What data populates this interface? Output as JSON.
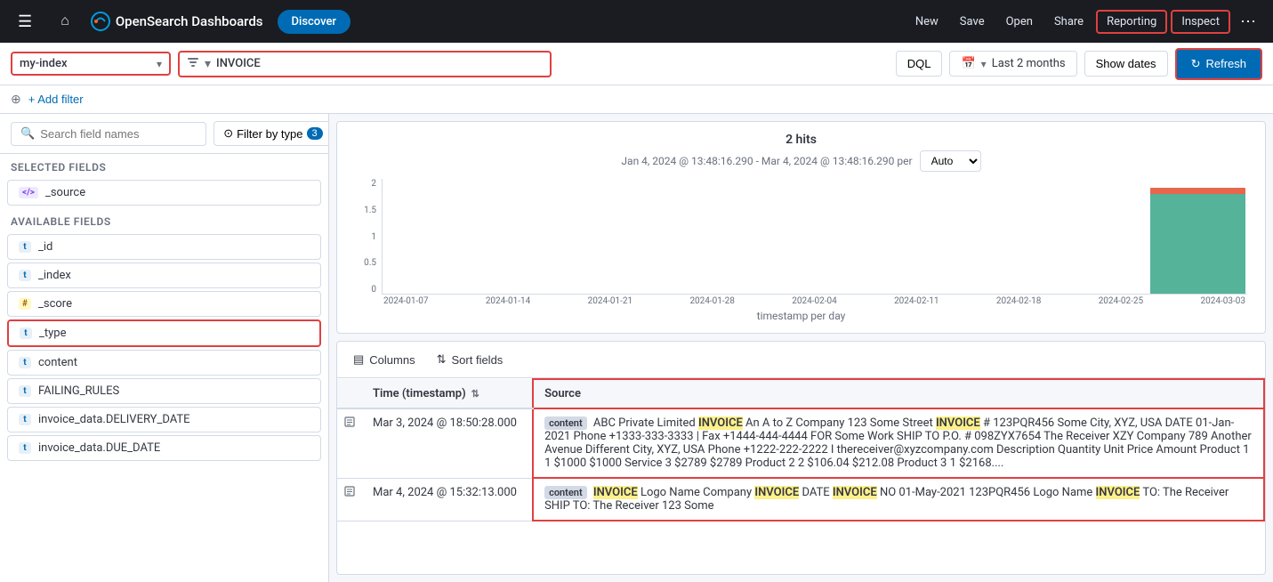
{
  "app": {
    "logo_text": "OpenSearch Dashboards",
    "active_tab": "Discover"
  },
  "top_nav": {
    "links": [
      "New",
      "Save",
      "Open",
      "Share",
      "Reporting",
      "Inspect"
    ],
    "hamburger_icon": "☰",
    "home_icon": "⌂"
  },
  "toolbar": {
    "index_name": "my-index",
    "query_text": "INVOICE",
    "dql_label": "DQL",
    "date_range": "Last 2 months",
    "show_dates_label": "Show dates",
    "refresh_label": "Refresh",
    "refresh_icon": "↻"
  },
  "filter_row": {
    "add_filter_label": "+ Add filter"
  },
  "sidebar": {
    "search_placeholder": "Search field names",
    "filter_by_type_label": "Filter by type",
    "filter_count": "3",
    "selected_section_label": "Selected fields",
    "available_section_label": "Available fields",
    "selected_fields": [
      {
        "type": "</>",
        "type_class": "code",
        "name": "_source"
      }
    ],
    "available_fields": [
      {
        "type": "t",
        "type_class": "text",
        "name": "_id"
      },
      {
        "type": "t",
        "type_class": "text",
        "name": "_index"
      },
      {
        "type": "#",
        "type_class": "hash",
        "name": "_score"
      },
      {
        "type": "t",
        "type_class": "text",
        "name": "_type"
      },
      {
        "type": "t",
        "type_class": "text",
        "name": "content"
      },
      {
        "type": "t",
        "type_class": "text",
        "name": "FAILING_RULES"
      },
      {
        "type": "t",
        "type_class": "text",
        "name": "invoice_data.DELIVERY_DATE"
      },
      {
        "type": "t",
        "type_class": "text",
        "name": "invoice_data.DUE_DATE"
      }
    ]
  },
  "chart": {
    "hits_label": "2 hits",
    "date_range_label": "Jan 4, 2024 @ 13:48:16.290 - Mar 4, 2024 @ 13:48:16.290 per",
    "per_label": "Auto",
    "x_axis_title": "timestamp per day",
    "y_labels": [
      "2",
      "1.5",
      "1",
      "0.5",
      "0"
    ],
    "x_labels": [
      "2024-01-07",
      "2024-01-14",
      "2024-01-21",
      "2024-01-28",
      "2024-02-04",
      "2024-02-11",
      "2024-02-18",
      "2024-02-25",
      "2024-03-03"
    ],
    "bars": [
      0,
      0,
      0,
      0,
      0,
      0,
      0,
      0,
      95
    ]
  },
  "results": {
    "columns_label": "Columns",
    "sort_fields_label": "Sort fields",
    "columns_icon": "▤",
    "sort_icon": "⇅",
    "headers": [
      {
        "label": "Time (timestamp)",
        "has_sort": true
      },
      {
        "label": "Source",
        "has_sort": false
      }
    ],
    "rows": [
      {
        "time": "Mar 3, 2024 @ 18:50:28.000",
        "source_prefix": "content",
        "source_text": " ABC Private Limited INVOICE An A to Z Company 123 Some Street INVOICE # 123PQR456 Some City, XYZ, USA DATE 01-Jan-2021 Phone +1333-333-3333 | Fax +1444-444-4444 FOR Some Work SHIP TO P.O. # 098ZYX7654 The Receiver XZY Company 789 Another Avenue Different City, XYZ, USA Phone +1222-222-2222 I thereceiver@xyzcompany.com Description Quantity Unit Price Amount Product 1 1 $1000 $1000 Service 3 $2789 $2789 Product 2 2 $106.04 $212.08 Product 3 1 $2168....",
        "highlights": [
          "INVOICE",
          "INVOICE"
        ]
      },
      {
        "time": "Mar 4, 2024 @ 15:32:13.000",
        "source_prefix": "content",
        "source_text": " INVOICE Logo Name Company INVOICE DATE INVOICE NO 01-May-2021 123PQR456 Logo Name INVOICE TO: The Receiver SHIP TO: The Receiver 123 Some",
        "highlights": [
          "INVOICE",
          "INVOICE",
          "INVOICE",
          "INVOICE"
        ]
      }
    ]
  }
}
